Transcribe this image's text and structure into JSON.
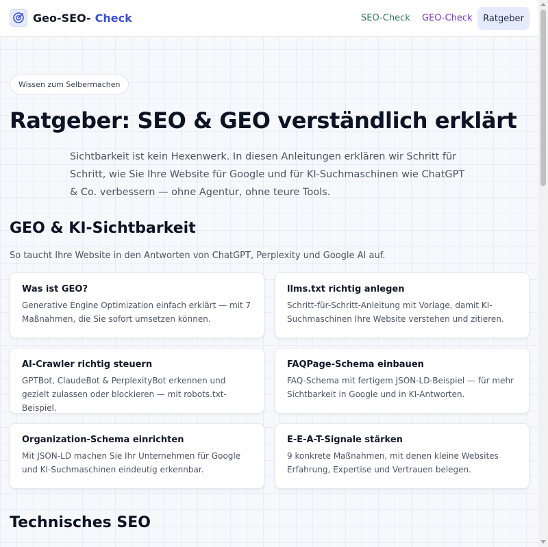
{
  "header": {
    "brand": "Geo-SEO-",
    "brand_accent": "Check",
    "nav": [
      {
        "label": "SEO-Check",
        "color": "#2f7a58"
      },
      {
        "label": "GEO-Check",
        "color": "#7a35c4"
      },
      {
        "label": "Ratgeber",
        "active": true
      }
    ]
  },
  "hero": {
    "badge": "Wissen zum Selbermachen",
    "title": "Ratgeber: SEO & GEO verständlich erklärt",
    "subtitle": "Sichtbarkeit ist kein Hexenwerk. In diesen Anleitungen erklären wir Schritt für Schritt, wie Sie Ihre Website für Google und für KI-Suchmaschinen wie ChatGPT & Co. verbessern — ohne Agentur, ohne teure Tools."
  },
  "sections": [
    {
      "title": "GEO & KI-Sichtbarkeit",
      "description": "So taucht Ihre Website in den Antworten von ChatGPT, Perplexity und Google AI auf.",
      "cards": [
        {
          "title": "Was ist GEO?",
          "description": "Generative Engine Optimization einfach erklärt — mit 7 Maßnahmen, die Sie sofort umsetzen können."
        },
        {
          "title": "llms.txt richtig anlegen",
          "description": "Schritt-für-Schritt-Anleitung mit Vorlage, damit KI-Suchmaschinen Ihre Website verstehen und zitieren."
        },
        {
          "title": "AI-Crawler richtig steuern",
          "description": "GPTBot, ClaudeBot & PerplexityBot erkennen und gezielt zulassen oder blockieren — mit robots.txt-Beispiel."
        },
        {
          "title": "FAQPage-Schema einbauen",
          "description": "FAQ-Schema mit fertigem JSON-LD-Beispiel — für mehr Sichtbarkeit in Google und in KI-Antworten."
        },
        {
          "title": "Organization-Schema einrichten",
          "description": "Mit JSON-LD machen Sie Ihr Unternehmen für Google und KI-Suchmaschinen eindeutig erkennbar."
        },
        {
          "title": "E-E-A-T-Signale stärken",
          "description": "9 konkrete Maßnahmen, mit denen kleine Websites Erfahrung, Expertise und Vertrauen belegen."
        }
      ]
    },
    {
      "title": "Technisches SEO"
    }
  ],
  "icons": {
    "logo": "target-icon"
  },
  "colors": {
    "accent": "#3b4fd4",
    "nav_active_bg": "#e6ebfb"
  }
}
